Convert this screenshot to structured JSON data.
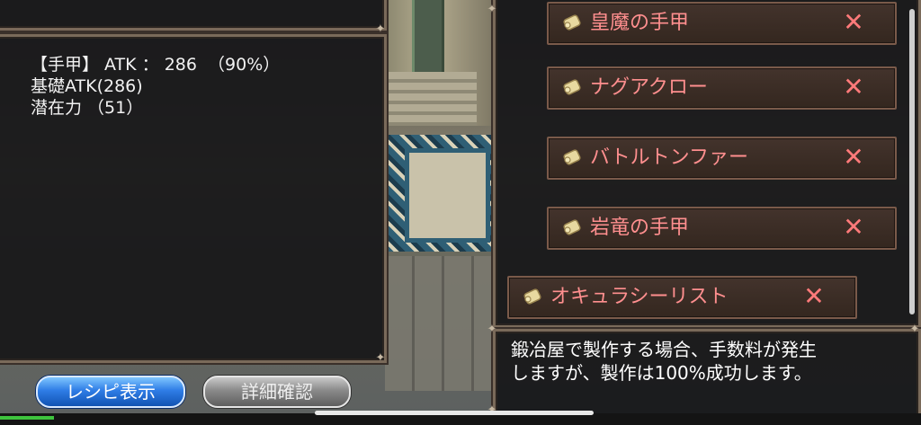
{
  "stats": {
    "line1": "【手甲】 ATK ： 286  （90%）",
    "line2": "基礎ATK(286)",
    "line3": "潜在力 （51）"
  },
  "recipe_list": [
    {
      "name": "皇魔の手甲",
      "icon": "scroll-icon",
      "remove": "✕"
    },
    {
      "name": "ナグアクロー",
      "icon": "scroll-icon",
      "remove": "✕"
    },
    {
      "name": "バトルトンファー",
      "icon": "scroll-icon",
      "remove": "✕"
    },
    {
      "name": "岩竜の手甲",
      "icon": "scroll-icon",
      "remove": "✕"
    },
    {
      "name": "オキュラシーリスト",
      "icon": "scroll-icon",
      "remove": "✕"
    }
  ],
  "info_text": {
    "line1": "鍛冶屋で製作する場合、手数料が発生",
    "line2": "しますが、製作は100%成功します。"
  },
  "buttons": {
    "recipe": "レシピ表示",
    "detail": "詳細確認"
  },
  "colors": {
    "item_text": "#ff8f8f",
    "remove_x": "#ff7a7a",
    "recipe_button": "#2f7de6",
    "detail_button": "#8a8a8a"
  }
}
